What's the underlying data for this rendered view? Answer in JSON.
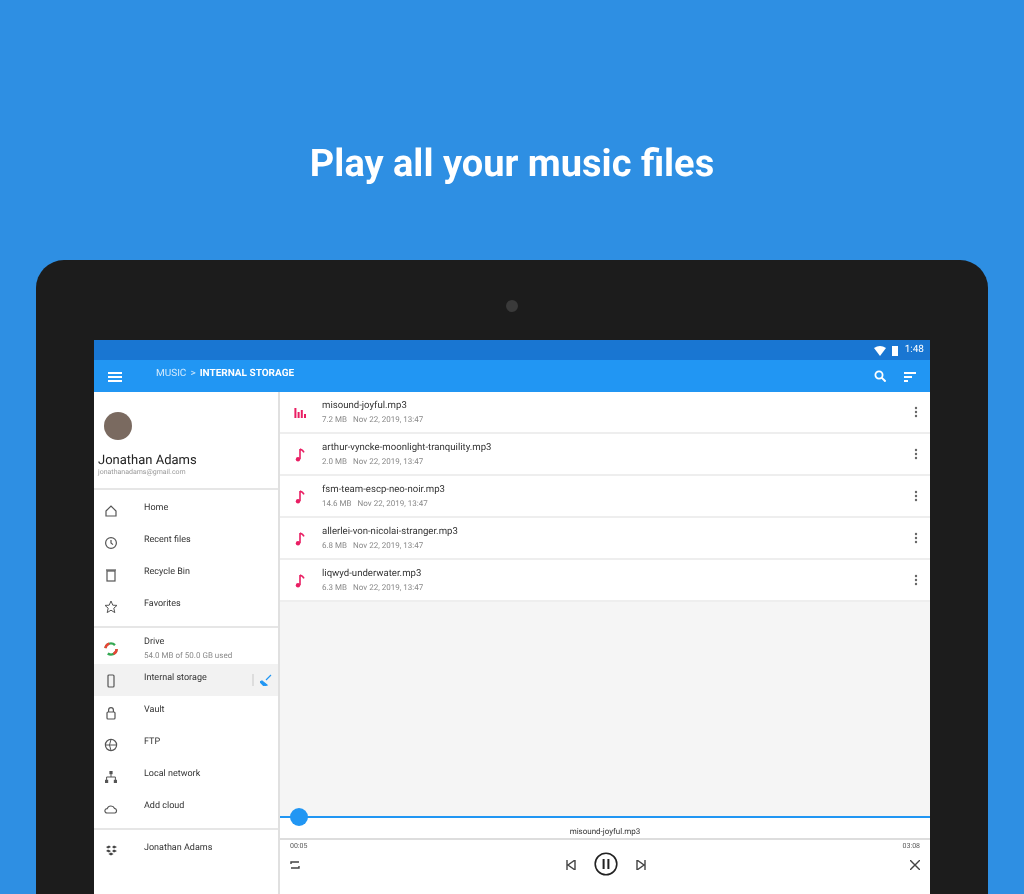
{
  "headline": "Play all your music files",
  "status_bar": {
    "time": "1:48"
  },
  "toolbar": {
    "breadcrumb": [
      {
        "label": "MUSIC",
        "selected": false
      },
      {
        "label": "INTERNAL STORAGE",
        "selected": true
      }
    ],
    "separator": ">"
  },
  "sidebar": {
    "user": {
      "name": "Jonathan Adams",
      "email": "jonathanadams@gmail.com"
    },
    "groups": [
      [
        {
          "label": "Home",
          "selected": false
        },
        {
          "label": "Recent files",
          "selected": false
        },
        {
          "label": "Recycle Bin",
          "selected": false
        },
        {
          "label": "Favorites",
          "selected": false
        }
      ],
      [
        {
          "label": "Drive",
          "detail": "54.0 MB of 50.0 GB used",
          "selected": false
        },
        {
          "label": "Internal storage",
          "selected": true
        },
        {
          "label": "Vault",
          "selected": false
        },
        {
          "label": "FTP",
          "selected": false
        },
        {
          "label": "Local network",
          "selected": false
        },
        {
          "label": "Add cloud",
          "selected": false
        }
      ],
      [
        {
          "label": "Jonathan Adams",
          "selected": false
        }
      ]
    ]
  },
  "files": [
    {
      "name": "misound-joyful.mp3",
      "size": "7.2 MB",
      "date": "Nov 22, 2019, 13:47",
      "playing": true
    },
    {
      "name": "arthur-vyncke-moonlight-tranquility.mp3",
      "size": "2.0 MB",
      "date": "Nov 22, 2019, 13:47",
      "playing": false
    },
    {
      "name": "fsm-team-escp-neo-noir.mp3",
      "size": "14.6 MB",
      "date": "Nov 22, 2019, 13:47",
      "playing": false
    },
    {
      "name": "allerlei-von-nicolai-stranger.mp3",
      "size": "6.8 MB",
      "date": "Nov 22, 2019, 13:47",
      "playing": false
    },
    {
      "name": "liqwyd-underwater.mp3",
      "size": "6.3 MB",
      "date": "Nov 22, 2019, 13:47",
      "playing": false
    }
  ],
  "player": {
    "title": "misound-joyful.mp3",
    "elapsed": "00:05",
    "duration": "03:08",
    "level": 0.03
  }
}
